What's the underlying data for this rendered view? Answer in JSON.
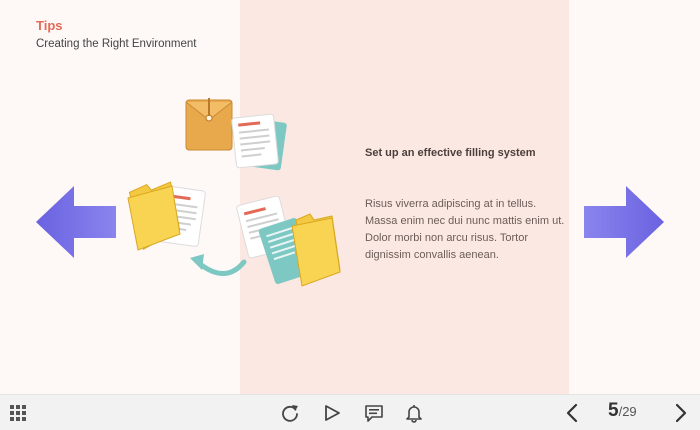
{
  "slide": {
    "tips_label": "Tips",
    "subtitle": "Creating the Right Environment",
    "heading": "Set up an effective filling system",
    "body": "Risus viverra adipiscing at in tellus. Massa enim nec dui nunc mattis enim ut. Dolor morbi non arcu risus. Tortor dignissim convallis aenean."
  },
  "colors": {
    "accent": "#e26a57",
    "arrow": "#7b74e6",
    "band": "#fce8e2",
    "background": "#fef8f6"
  },
  "toolbar": {
    "icons": [
      "menu-grid-icon",
      "replay-icon",
      "play-icon",
      "notes-icon",
      "bell-icon",
      "chevron-left-icon",
      "chevron-right-icon"
    ],
    "current_page": "5",
    "total_pages": "/29"
  }
}
